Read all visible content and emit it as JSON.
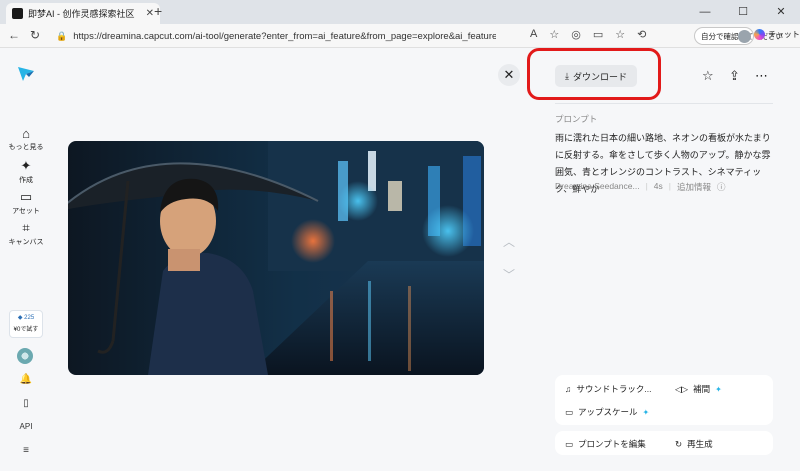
{
  "browser": {
    "tab_title": "即梦AI - 创作灵感探索社区",
    "url": "https://dreamina.capcut.com/ai-tool/generate?enter_from=ai_feature&from_page=explore&ai_feature_name=omniReferen...",
    "signin_label": "自分で確認してください",
    "copilot_label": "チャット"
  },
  "sidebar": {
    "items": [
      {
        "label": "もっと見る",
        "icon": "home-icon"
      },
      {
        "label": "作成",
        "icon": "sparkle-icon"
      },
      {
        "label": "アセット",
        "icon": "folder-icon"
      },
      {
        "label": "キャンバス",
        "icon": "canvas-icon"
      }
    ],
    "credits": "225",
    "free_label": "¥0で試す",
    "api_label": "API"
  },
  "viewer": {
    "download_label": "ダウンロード"
  },
  "prompt": {
    "label": "プロンプト",
    "text": "雨に濡れた日本の細い路地、ネオンの看板が水たまりに反射する。傘をさして歩く人物のアップ。静かな雰囲気、青とオレンジのコントラスト、シネマティック、鮮やか",
    "model": "Dreamina Seedance...",
    "duration": "4s",
    "more_info": "追加情報"
  },
  "tools": {
    "soundtrack": "サウンドトラック...",
    "interpolate": "補間",
    "upscale": "アップスケール",
    "edit_prompt": "プロンプトを編集",
    "regenerate": "再生成"
  },
  "colors": {
    "accent_highlight": "#e21a1a",
    "brand": "#27b4e6"
  }
}
